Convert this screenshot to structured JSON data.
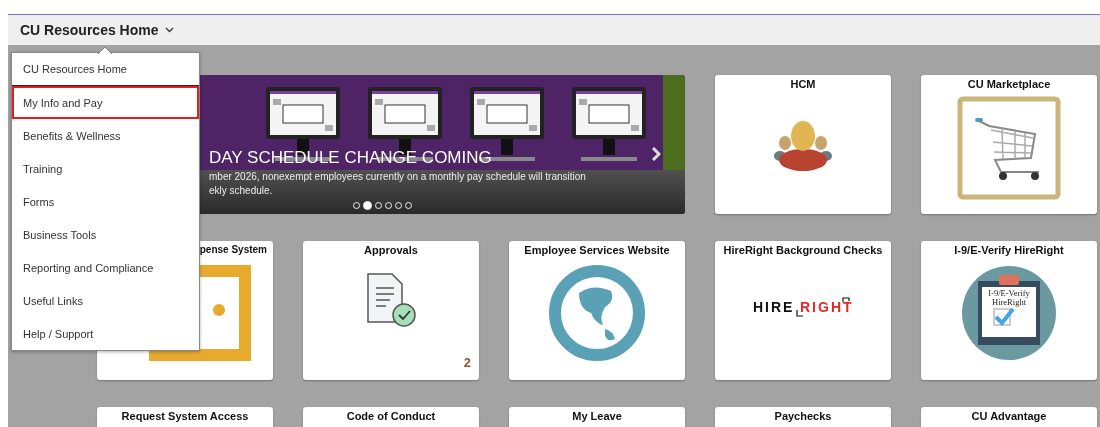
{
  "header": {
    "title": "CU Resources Home"
  },
  "menu": {
    "items": [
      {
        "label": "CU Resources Home",
        "selected": false
      },
      {
        "label": "My Info and Pay",
        "selected": true
      },
      {
        "label": "Benefits & Wellness",
        "selected": false
      },
      {
        "label": "Training",
        "selected": false
      },
      {
        "label": "Forms",
        "selected": false
      },
      {
        "label": "Business Tools",
        "selected": false
      },
      {
        "label": "Reporting and Compliance",
        "selected": false
      },
      {
        "label": "Useful Links",
        "selected": false
      },
      {
        "label": "Help / Support",
        "selected": false
      }
    ]
  },
  "carousel": {
    "headline": "DAY SCHEDULE CHANGE COMING",
    "text_lines": [
      "mber 2026, nonexempt employees currently on a monthly pay schedule will transition",
      "ekly schedule."
    ],
    "pages": [
      {
        "selected": false
      },
      {
        "selected": true
      },
      {
        "selected": false
      },
      {
        "selected": false
      },
      {
        "selected": false
      },
      {
        "selected": false
      }
    ]
  },
  "tiles": [
    {
      "title": "HCM",
      "kind": "people"
    },
    {
      "title": "CU Marketplace",
      "kind": "cart"
    },
    {
      "title": "pense System",
      "kind": "expense"
    },
    {
      "title": "Approvals",
      "kind": "approvals",
      "badge": "2"
    },
    {
      "title": "Employee Services Website",
      "kind": "globe"
    },
    {
      "title": "HireRight Background Checks",
      "kind": "hireright",
      "logo": [
        "HIRE",
        "RIGHT"
      ]
    },
    {
      "title": "I-9/E-Verify HireRight",
      "kind": "clipboard",
      "caption": [
        "I-9/E-Verify",
        "HireRight"
      ]
    },
    {
      "title": "Request System Access",
      "kind": "none"
    },
    {
      "title": "Code of Conduct",
      "kind": "none"
    },
    {
      "title": "My Leave",
      "kind": "none"
    },
    {
      "title": "Paychecks",
      "kind": "none"
    },
    {
      "title": "CU Advantage",
      "kind": "none"
    }
  ]
}
